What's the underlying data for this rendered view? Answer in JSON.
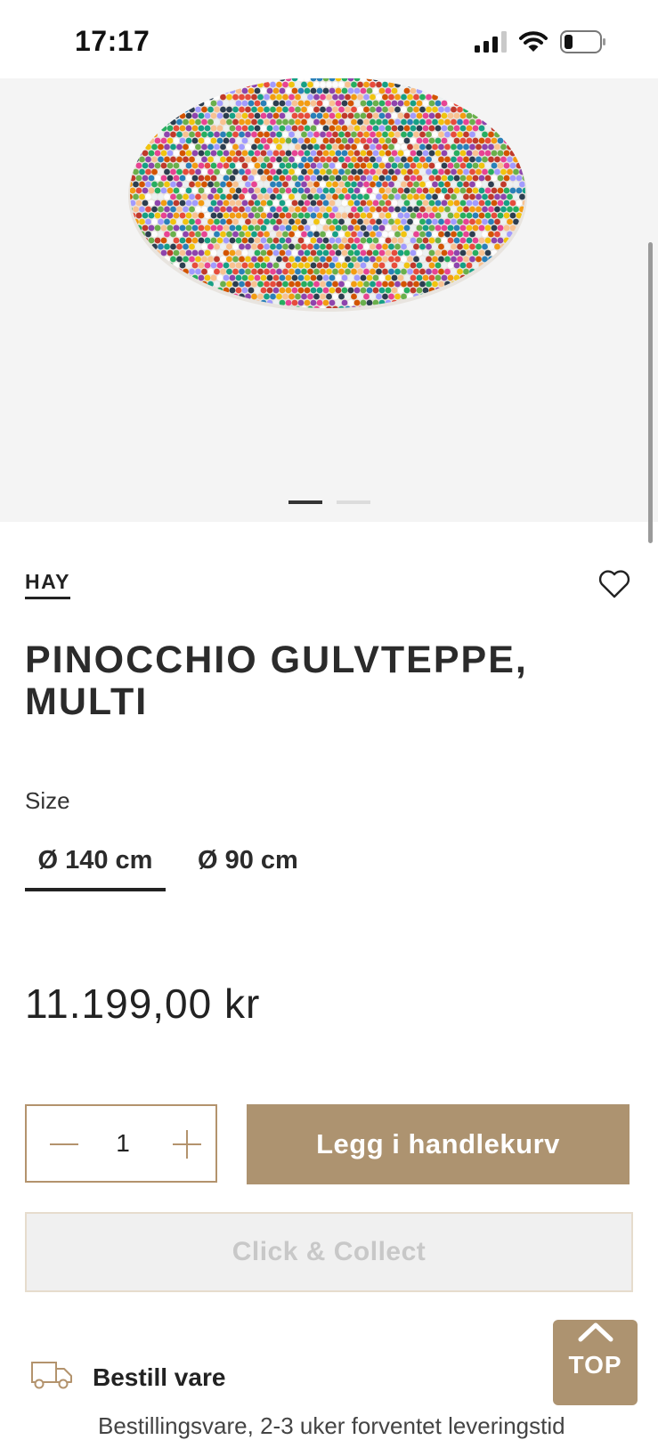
{
  "status_bar": {
    "time": "17:17",
    "icons": [
      "signal-icon",
      "wifi-icon",
      "battery-icon"
    ]
  },
  "gallery": {
    "image": "round multicolor felt ball rug",
    "slides": 2,
    "active_slide": 1
  },
  "product": {
    "brand": "HAY",
    "title": "PINOCCHIO GULVTEPPE, MULTI",
    "size_label": "Size",
    "sizes": [
      "Ø 140 cm",
      "Ø 90 cm"
    ],
    "selected_size": "Ø 140 cm",
    "price": "11.199,00 kr"
  },
  "purchase": {
    "quantity": "1",
    "add_to_cart_label": "Legg i handlekurv",
    "click_collect_label": "Click & Collect"
  },
  "delivery": {
    "label": "Bestill vare",
    "info_partial": "Bestillingsvare, 2-3 uker forventet leveringstid"
  },
  "back_to_top": {
    "label": "TOP"
  },
  "colors": {
    "accent": "#ad9370",
    "text": "#2b2b2b",
    "hero_bg": "#f4f4f4",
    "disabled_bg": "#f0f0f0"
  }
}
